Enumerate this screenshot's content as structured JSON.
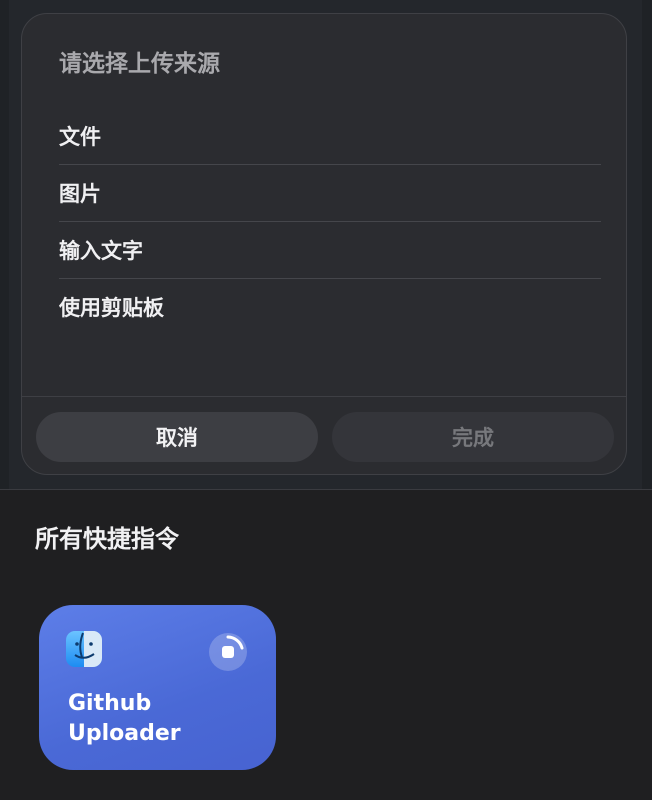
{
  "dialog": {
    "title": "请选择上传来源",
    "options": [
      "文件",
      "图片",
      "输入文字",
      "使用剪贴板"
    ],
    "cancel_label": "取消",
    "done_label": "完成"
  },
  "shortcuts": {
    "section_title": "所有快捷指令",
    "tile": {
      "name_line1": "Github",
      "name_line2": "Uploader",
      "icon": "finder-icon",
      "status": "running-progress-icon"
    }
  },
  "colors": {
    "tile_accent": "#4f6ddb",
    "dialog_bg": "#2b2c30",
    "background": "#1f1f21"
  }
}
